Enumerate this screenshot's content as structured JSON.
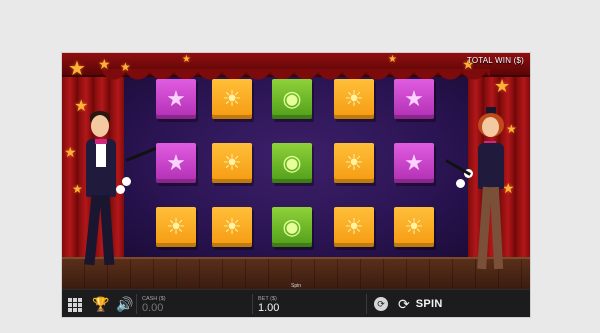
{
  "game": {
    "total_win_label": "TOTAL WIN ($)",
    "reels": [
      [
        "star",
        "sun",
        "planet",
        "sun",
        "star"
      ],
      [
        "star",
        "sun",
        "planet",
        "sun",
        "star"
      ],
      [
        "sun",
        "sun",
        "planet",
        "sun",
        "sun"
      ]
    ],
    "symbol_icons": {
      "sun": "sun-icon",
      "star": "star-icon",
      "planet": "planet-icon"
    }
  },
  "bottom_bar": {
    "spin_caption": "Spin",
    "cash": {
      "label": "CASH ($)",
      "value": "0.00"
    },
    "bet": {
      "label": "BET ($)",
      "value": "1.00"
    },
    "spin_label": "SPIN"
  },
  "colors": {
    "sun": "#f59a12",
    "star": "#b12fb4",
    "planet": "#4f9e1a",
    "bar_background": "#1c1c1e",
    "curtain": "#b3171a"
  }
}
